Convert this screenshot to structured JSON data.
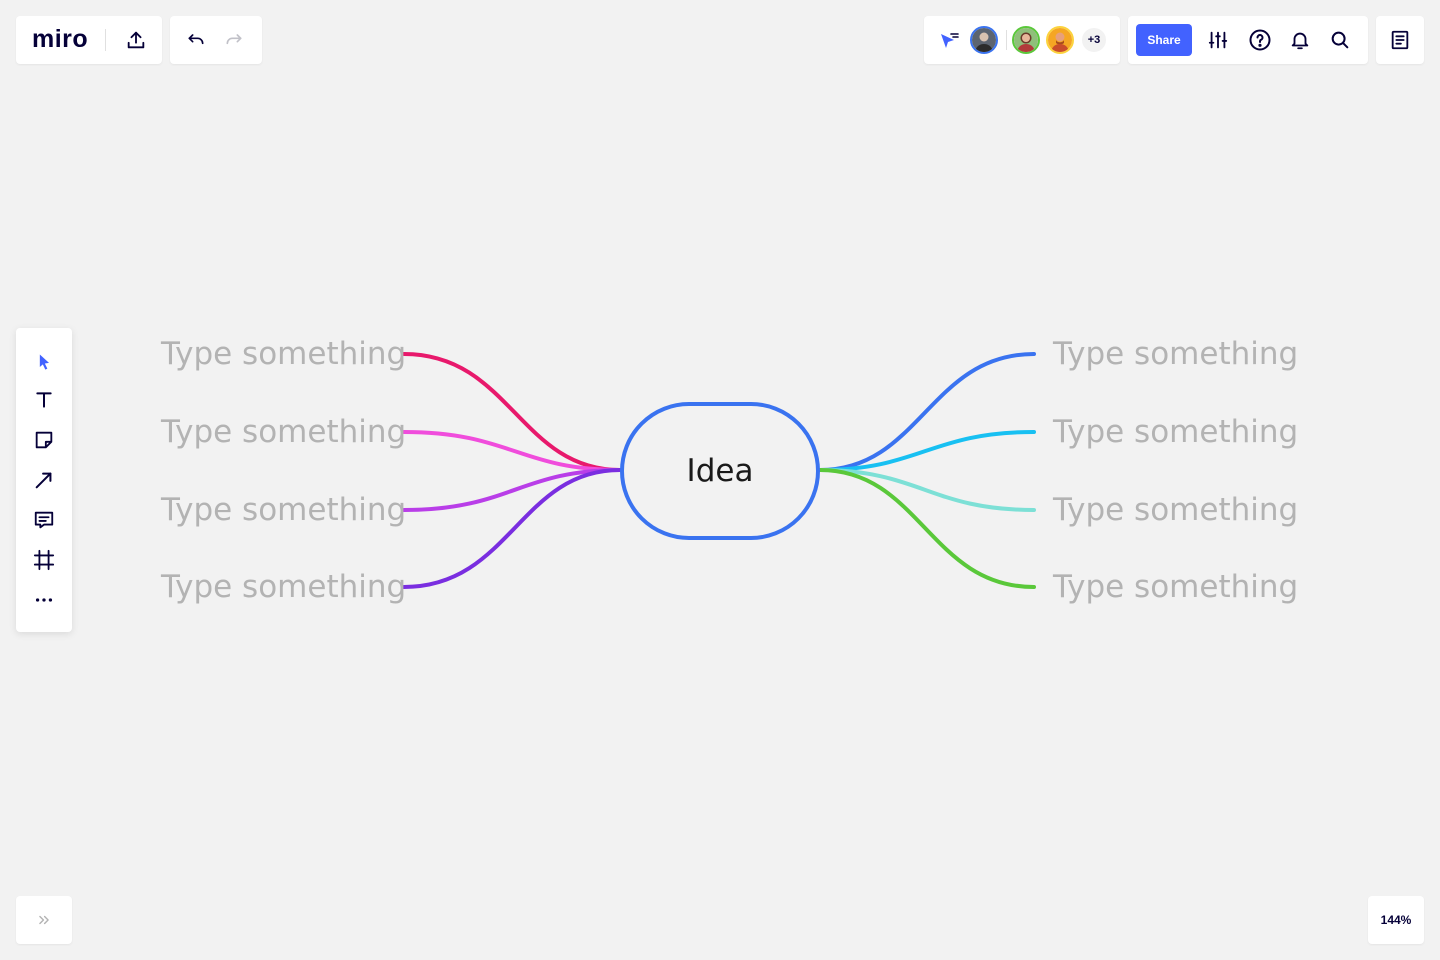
{
  "app": {
    "logo": "miro"
  },
  "collaborators": {
    "extra_count": "+3"
  },
  "share_bar": {
    "share_label": "Share"
  },
  "zoom": {
    "level": "144%"
  },
  "mindmap": {
    "central": "Idea",
    "left_branches": [
      {
        "text": "Type something",
        "color": "#e8196c"
      },
      {
        "text": "Type something",
        "color": "#f04ddc"
      },
      {
        "text": "Type something",
        "color": "#b93ee8"
      },
      {
        "text": "Type something",
        "color": "#7a2ee0"
      }
    ],
    "right_branches": [
      {
        "text": "Type something",
        "color": "#3a73f0"
      },
      {
        "text": "Type something",
        "color": "#18c0f2"
      },
      {
        "text": "Type something",
        "color": "#7de0d6"
      },
      {
        "text": "Type something",
        "color": "#5ac83a"
      }
    ]
  },
  "colors": {
    "accent": "#4262ff",
    "central_border": "#3a73f0"
  }
}
